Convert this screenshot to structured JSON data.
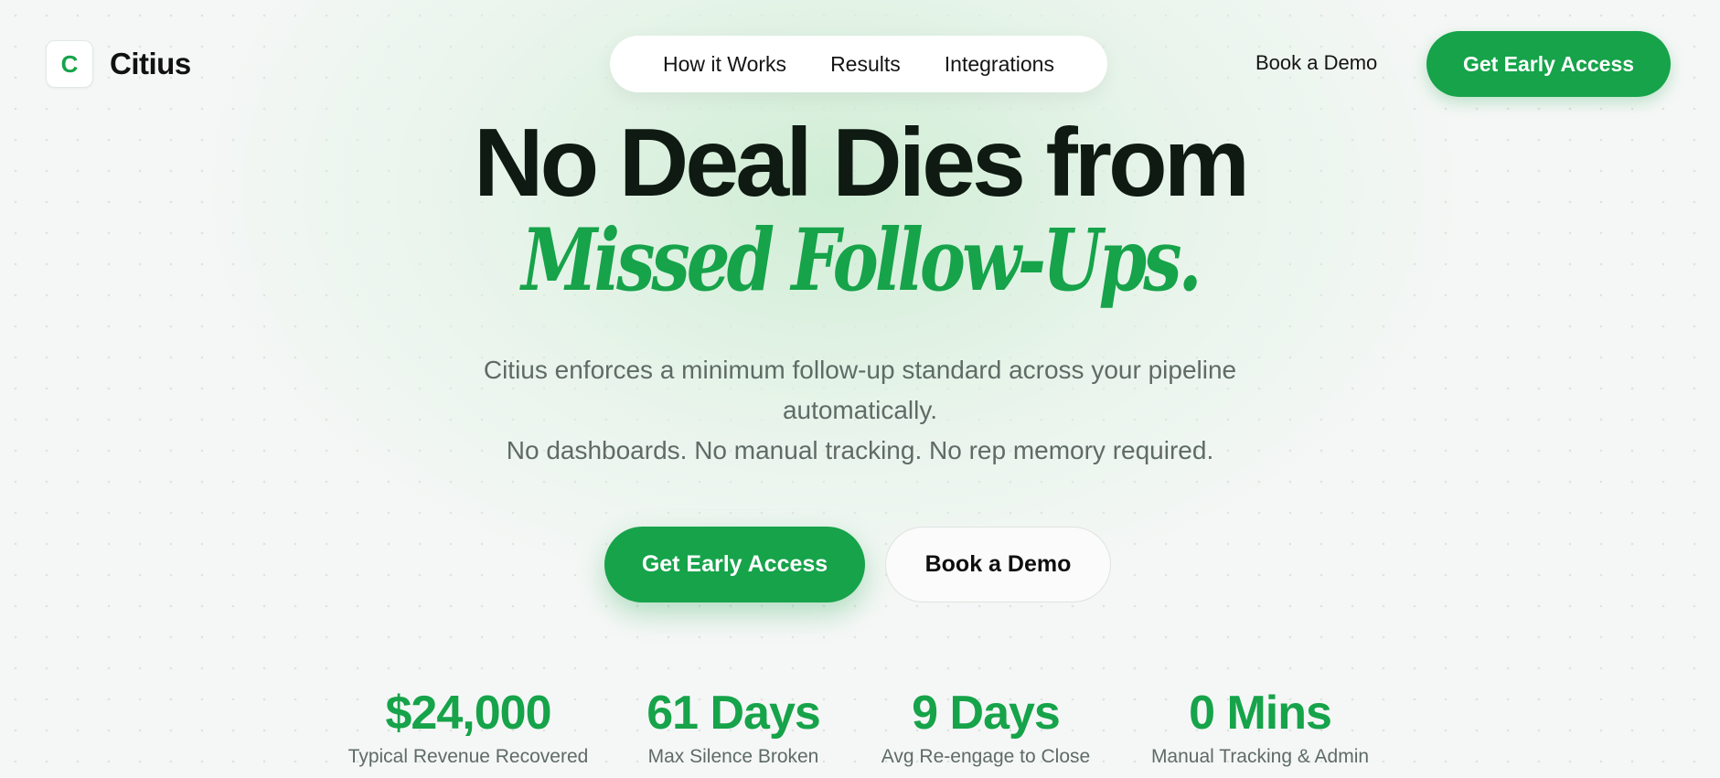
{
  "brand": {
    "logo_letter": "C",
    "name": "Citius",
    "accent_color": "#16a34a"
  },
  "nav": {
    "links": [
      "How it Works",
      "Results",
      "Integrations"
    ],
    "book_demo": "Book a Demo",
    "cta": "Get Early Access"
  },
  "hero": {
    "headline": "No Deal Dies from",
    "headline_accent": "Missed Follow-Ups.",
    "subtitle_line1": "Citius enforces a minimum follow-up standard across your pipeline",
    "subtitle_line2": "automatically.",
    "subtitle_line3": "No dashboards. No manual tracking. No rep memory required.",
    "primary_button": "Get Early Access",
    "secondary_button": "Book a Demo"
  },
  "stats": [
    {
      "value": "$24,000",
      "label": "Typical Revenue Recovered"
    },
    {
      "value": "61 Days",
      "label": "Max Silence Broken"
    },
    {
      "value": "9 Days",
      "label": "Avg Re-engage to Close"
    },
    {
      "value": "0 Mins",
      "label": "Manual Tracking & Admin"
    }
  ]
}
